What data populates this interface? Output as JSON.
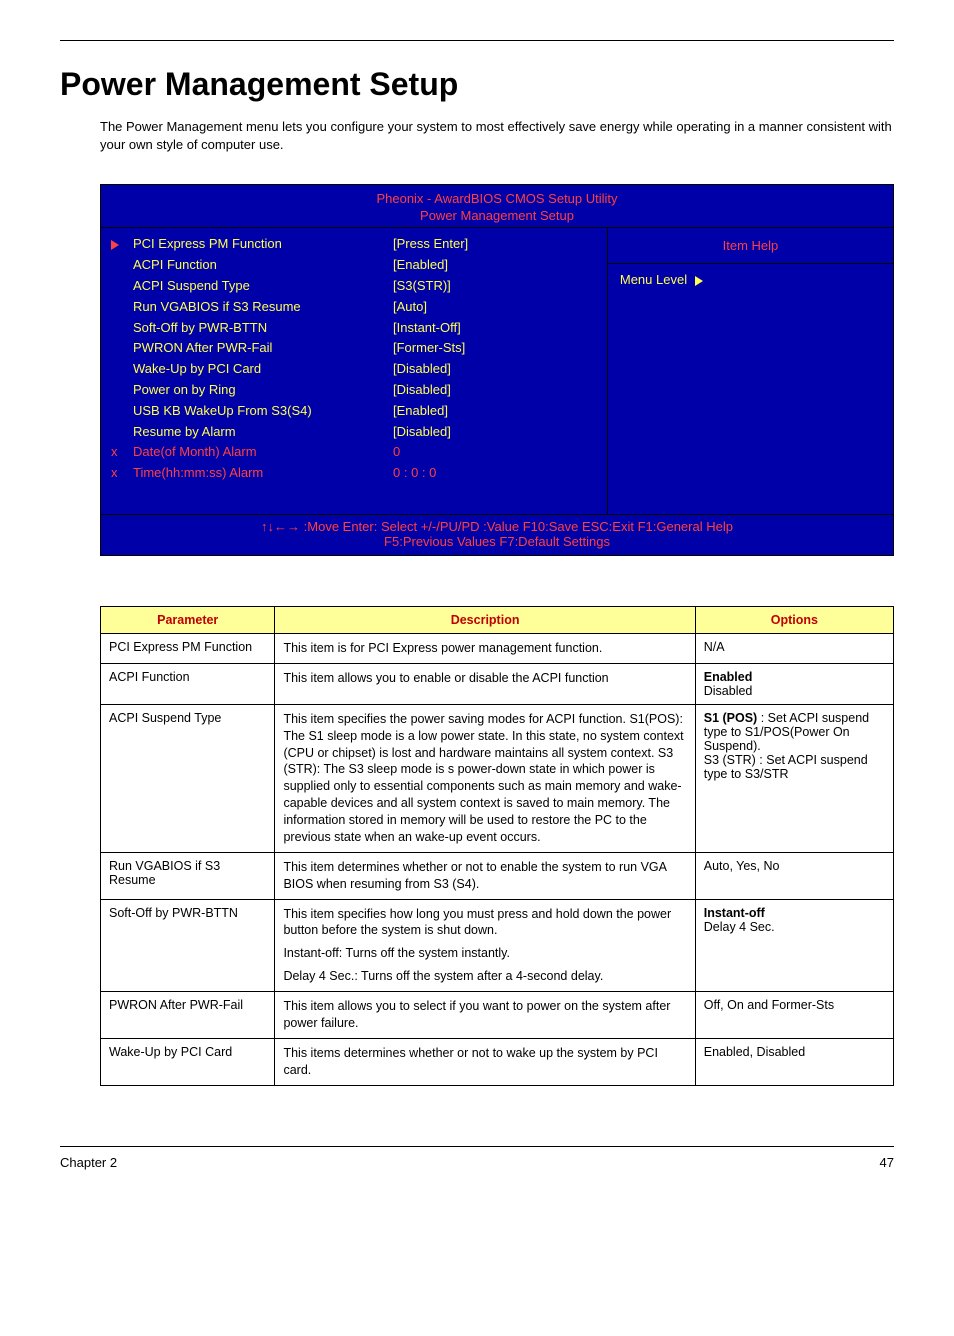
{
  "page": {
    "title": "Power Management Setup",
    "intro": "The Power Management menu lets you configure your system to most effectively save energy while operating in a manner consistent with your own style of computer use."
  },
  "bios": {
    "header": "Pheonix - AwardBIOS CMOS Setup Utility",
    "subheader": "Power Management Setup",
    "rows": [
      {
        "marker": "tri",
        "label": "PCI Express PM Function",
        "value": "[Press Enter]",
        "labelClass": "",
        "valueClass": ""
      },
      {
        "marker": "",
        "label": "ACPI Function",
        "value": "[Enabled]",
        "labelClass": "",
        "valueClass": ""
      },
      {
        "marker": "",
        "label": "ACPI Suspend Type",
        "value": "[S3(STR)]",
        "labelClass": "",
        "valueClass": ""
      },
      {
        "marker": "",
        "label": "Run VGABIOS if S3 Resume",
        "value": "[Auto]",
        "labelClass": "",
        "valueClass": ""
      },
      {
        "marker": "",
        "label": "Soft-Off by PWR-BTTN",
        "value": "[Instant-Off]",
        "labelClass": "",
        "valueClass": ""
      },
      {
        "marker": "",
        "label": "PWRON After PWR-Fail",
        "value": "[Former-Sts]",
        "labelClass": "",
        "valueClass": ""
      },
      {
        "marker": "",
        "label": "Wake-Up by PCI Card",
        "value": "[Disabled]",
        "labelClass": "",
        "valueClass": ""
      },
      {
        "marker": "",
        "label": "Power on by Ring",
        "value": "[Disabled]",
        "labelClass": "",
        "valueClass": ""
      },
      {
        "marker": "",
        "label": "USB KB WakeUp From S3(S4)",
        "value": "[Enabled]",
        "labelClass": "",
        "valueClass": ""
      },
      {
        "marker": "",
        "label": "Resume by Alarm",
        "value": "[Disabled]",
        "labelClass": "",
        "valueClass": ""
      },
      {
        "marker": "x",
        "label": "Date(of Month) Alarm",
        "value": "0",
        "labelClass": "red",
        "valueClass": "red"
      },
      {
        "marker": "x",
        "label": "Time(hh:mm:ss) Alarm",
        "value": "0 : 0 : 0",
        "labelClass": "red",
        "valueClass": "red"
      }
    ],
    "help_title": "Item Help",
    "help_body": "Menu Level",
    "footer1": "↑↓←→ :Move  Enter: Select   +/-/PU/PD :Value F10:Save  ESC:Exit  F1:General Help",
    "footer2": "F5:Previous Values  F7:Default Settings"
  },
  "table": {
    "headers": {
      "param": "Parameter",
      "desc": "Description",
      "opts": "Options"
    },
    "rows": [
      {
        "param": "PCI Express PM Function",
        "desc": [
          "This item is for PCI Express power management function."
        ],
        "opts_html": "N/A"
      },
      {
        "param": "ACPI Function",
        "desc": [
          "This item allows you to enable or disable the ACPI function"
        ],
        "opts_html": "<b>Enabled</b><br>Disabled"
      },
      {
        "param": "ACPI Suspend Type",
        "desc": [
          "This item specifies the power saving modes for ACPI function.  S1(POS): The S1 sleep mode is a low power state. In this state, no system context (CPU or chipset) is lost and hardware maintains all system context.  S3 (STR): The S3 sleep mode is s power-down state in which power is supplied only to essential components such as main memory and wake-capable devices and all system context is saved to main memory.  The information stored in memory will be used to restore the PC to the previous state when an wake-up event occurs."
        ],
        "opts_html": "<b>S1 (POS)</b> : Set ACPI suspend type to S1/POS(Power On Suspend).<br>S3 (STR) : Set ACPI suspend type to S3/STR"
      },
      {
        "param": "Run VGABIOS if S3 Resume",
        "desc": [
          "This item determines whether or not to enable the system to run VGA BIOS when resuming from S3 (S4)."
        ],
        "opts_html": "Auto, Yes, No"
      },
      {
        "param": "Soft-Off by PWR-BTTN",
        "desc": [
          "This item specifies how long you must press and hold down the power button before the system is shut down.",
          "Instant-off: Turns off the system instantly.",
          "Delay 4 Sec.: Turns off the system after a 4-second delay."
        ],
        "opts_html": "<b>Instant-off</b><br>Delay 4 Sec."
      },
      {
        "param": "PWRON After PWR-Fail",
        "desc": [
          "This item allows you to select if you want to power on the system after power failure."
        ],
        "opts_html": "Off, On and Former-Sts"
      },
      {
        "param": "Wake-Up by PCI Card",
        "desc": [
          "This items determines whether or not to wake up the system by PCI card."
        ],
        "opts_html": "Enabled, Disabled"
      }
    ]
  },
  "footer": {
    "left": "Chapter 2",
    "right": "47"
  }
}
